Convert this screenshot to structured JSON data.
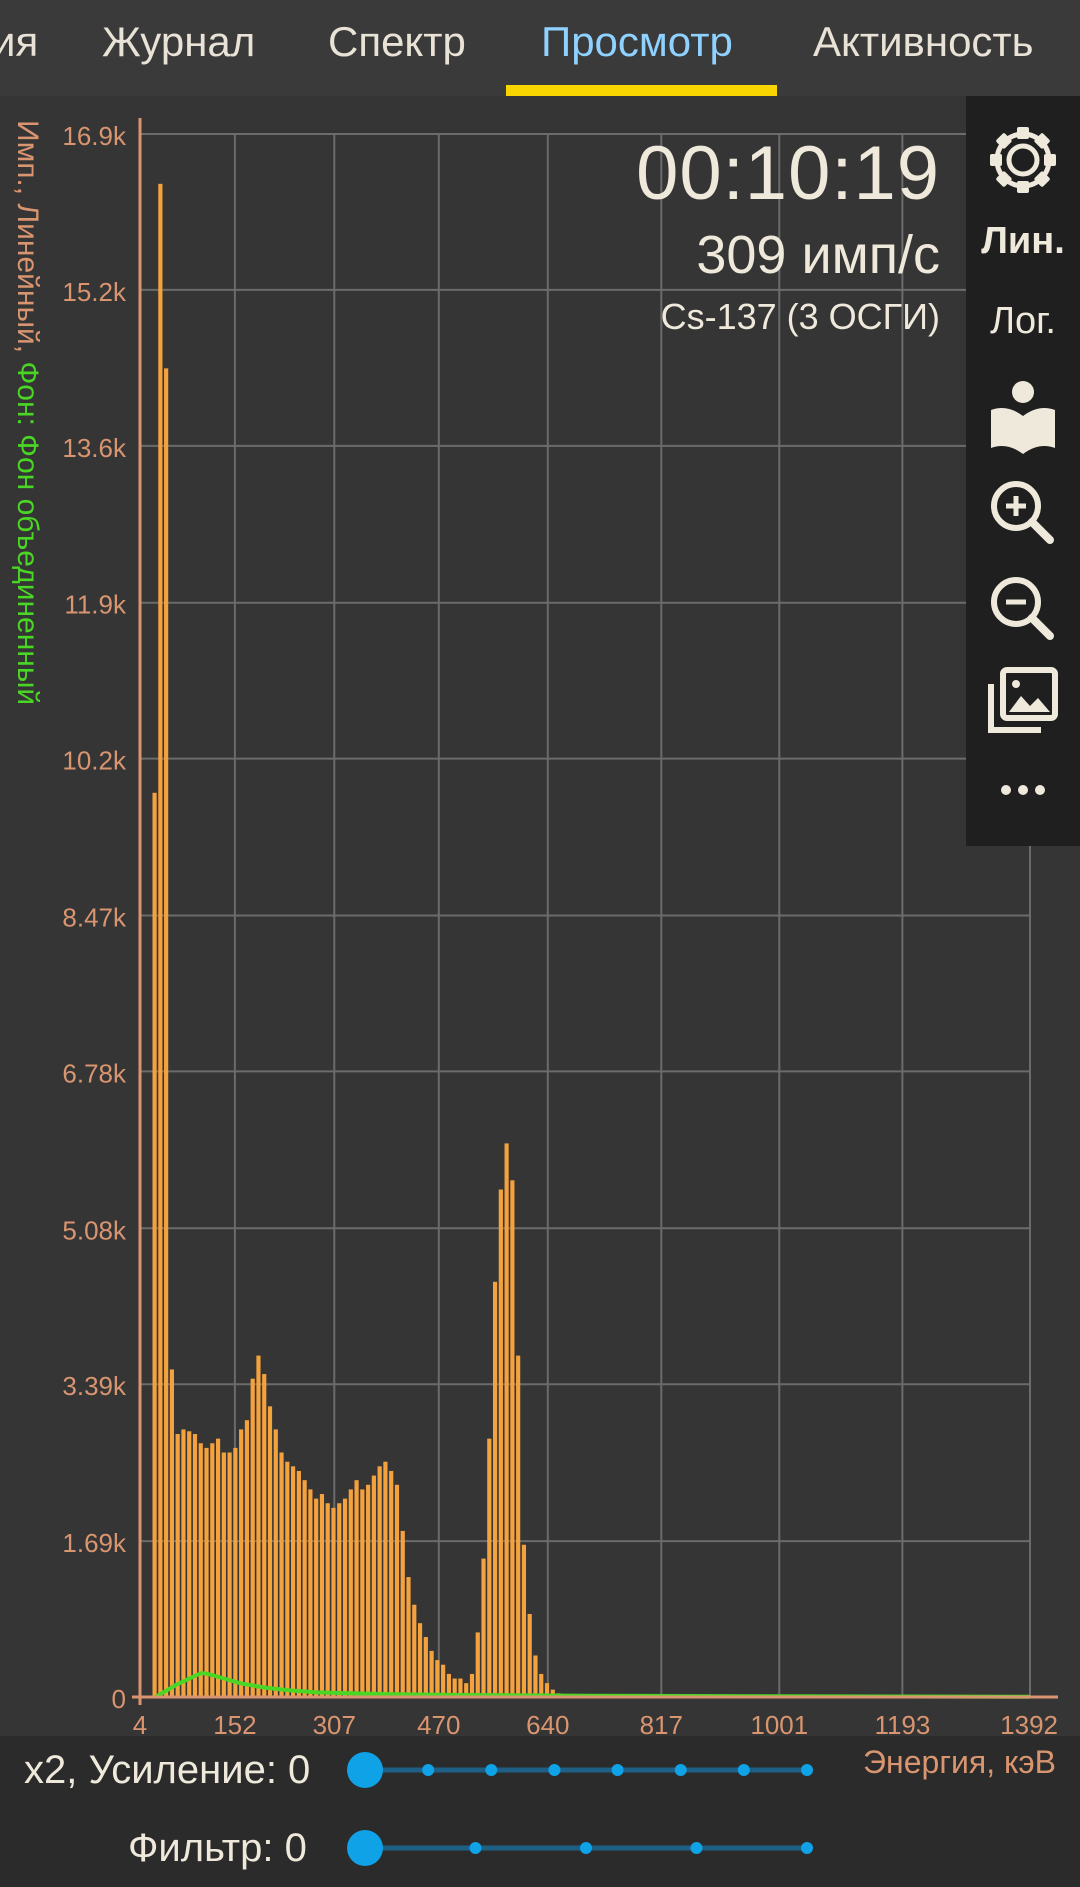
{
  "tabs": [
    {
      "label": "ия",
      "active": false
    },
    {
      "label": "Журнал",
      "active": false
    },
    {
      "label": "Спектр",
      "active": false
    },
    {
      "label": "Просмотр",
      "active": true
    },
    {
      "label": "Активность",
      "active": false
    }
  ],
  "overlay": {
    "timer": "00:10:19",
    "rate": "309  имп/с",
    "source": "Cs-137 (3 ОСГИ)"
  },
  "toolbar": {
    "linear_label": "Лин.",
    "log_label": "Лог.",
    "icons": [
      "gear-icon",
      "library-icon",
      "zoom-in-icon",
      "zoom-out-icon",
      "gallery-icon",
      "more-icon"
    ],
    "selected_scale": "linear"
  },
  "chart_data": {
    "type": "bar",
    "ylabel_main": "Имп., Линейный, ",
    "ylabel_bg": "Фон: Фон объединенный",
    "xlabel": "Энергия, кэВ",
    "x_ticks": [
      "4",
      "152",
      "307",
      "470",
      "640",
      "817",
      "1001",
      "1193",
      "1392"
    ],
    "x_tick_values": [
      4,
      152,
      307,
      470,
      640,
      817,
      1001,
      1193,
      1392
    ],
    "y_ticks": [
      "0",
      "1.69k",
      "3.39k",
      "5.08k",
      "6.78k",
      "8.47k",
      "10.2k",
      "11.9k",
      "13.6k",
      "15.2k",
      "16.9k"
    ],
    "y_tick_values": [
      0,
      1690,
      3390,
      5080,
      6780,
      8470,
      10170,
      11860,
      13560,
      15250,
      16940
    ],
    "xlim": [
      4,
      1392
    ],
    "ylim": [
      0,
      16940
    ],
    "bin_width_kev": 9,
    "series": [
      {
        "name": "Спектр",
        "color": "#f4a23e",
        "x": [
          28,
          37,
          46,
          55,
          64,
          73,
          82,
          91,
          100,
          109,
          118,
          127,
          136,
          145,
          154,
          163,
          172,
          181,
          190,
          199,
          208,
          217,
          226,
          235,
          244,
          253,
          262,
          271,
          280,
          289,
          298,
          307,
          316,
          325,
          334,
          343,
          352,
          361,
          370,
          379,
          388,
          397,
          406,
          415,
          424,
          433,
          442,
          451,
          460,
          469,
          478,
          487,
          496,
          505,
          514,
          523,
          532,
          541,
          550,
          559,
          568,
          577,
          586,
          595,
          604,
          613,
          622,
          631,
          640,
          649,
          658,
          667,
          676,
          685,
          694,
          703,
          712,
          721,
          730,
          739,
          748
        ],
        "values": [
          9800,
          16400,
          14400,
          3550,
          2850,
          2900,
          2880,
          2850,
          2750,
          2700,
          2750,
          2800,
          2650,
          2650,
          2700,
          2900,
          3000,
          3450,
          3700,
          3500,
          3150,
          2900,
          2650,
          2550,
          2500,
          2450,
          2350,
          2250,
          2150,
          2200,
          2100,
          2050,
          2100,
          2150,
          2250,
          2350,
          2250,
          2300,
          2400,
          2500,
          2550,
          2450,
          2300,
          1800,
          1300,
          1000,
          800,
          650,
          500,
          400,
          350,
          250,
          200,
          200,
          150,
          250,
          700,
          1500,
          2800,
          4500,
          5500,
          6000,
          5600,
          3700,
          1650,
          900,
          450,
          250,
          150,
          80,
          40,
          20,
          10,
          0,
          0,
          0,
          0,
          0,
          0,
          0,
          0
        ],
        "trim_leading": 0
      },
      {
        "name": "Фон объединенный",
        "color": "#4ad624",
        "x": [
          28,
          60,
          90,
          100,
          110,
          130,
          160,
          200,
          240,
          280,
          330,
          400,
          500,
          600,
          700,
          800,
          1000,
          1200,
          1392
        ],
        "values": [
          0,
          130,
          230,
          260,
          250,
          210,
          150,
          100,
          70,
          50,
          40,
          30,
          22,
          18,
          14,
          12,
          8,
          5,
          3
        ]
      }
    ]
  },
  "controls": {
    "gain_label": "x2, Усиление: 0",
    "filter_label": "Фильтр: 0",
    "gain_value": 0,
    "gain_steps": 8,
    "filter_value": 0,
    "filter_steps": 5,
    "accent": "#0fa2e6"
  },
  "colors": {
    "tab_active": "#8fd1ff",
    "tab_indicator": "#f8d500",
    "axis_orange": "#d99570",
    "bar_orange": "#f4a23e",
    "background_green": "#4ad624",
    "slider_blue": "#0fa2e6"
  }
}
